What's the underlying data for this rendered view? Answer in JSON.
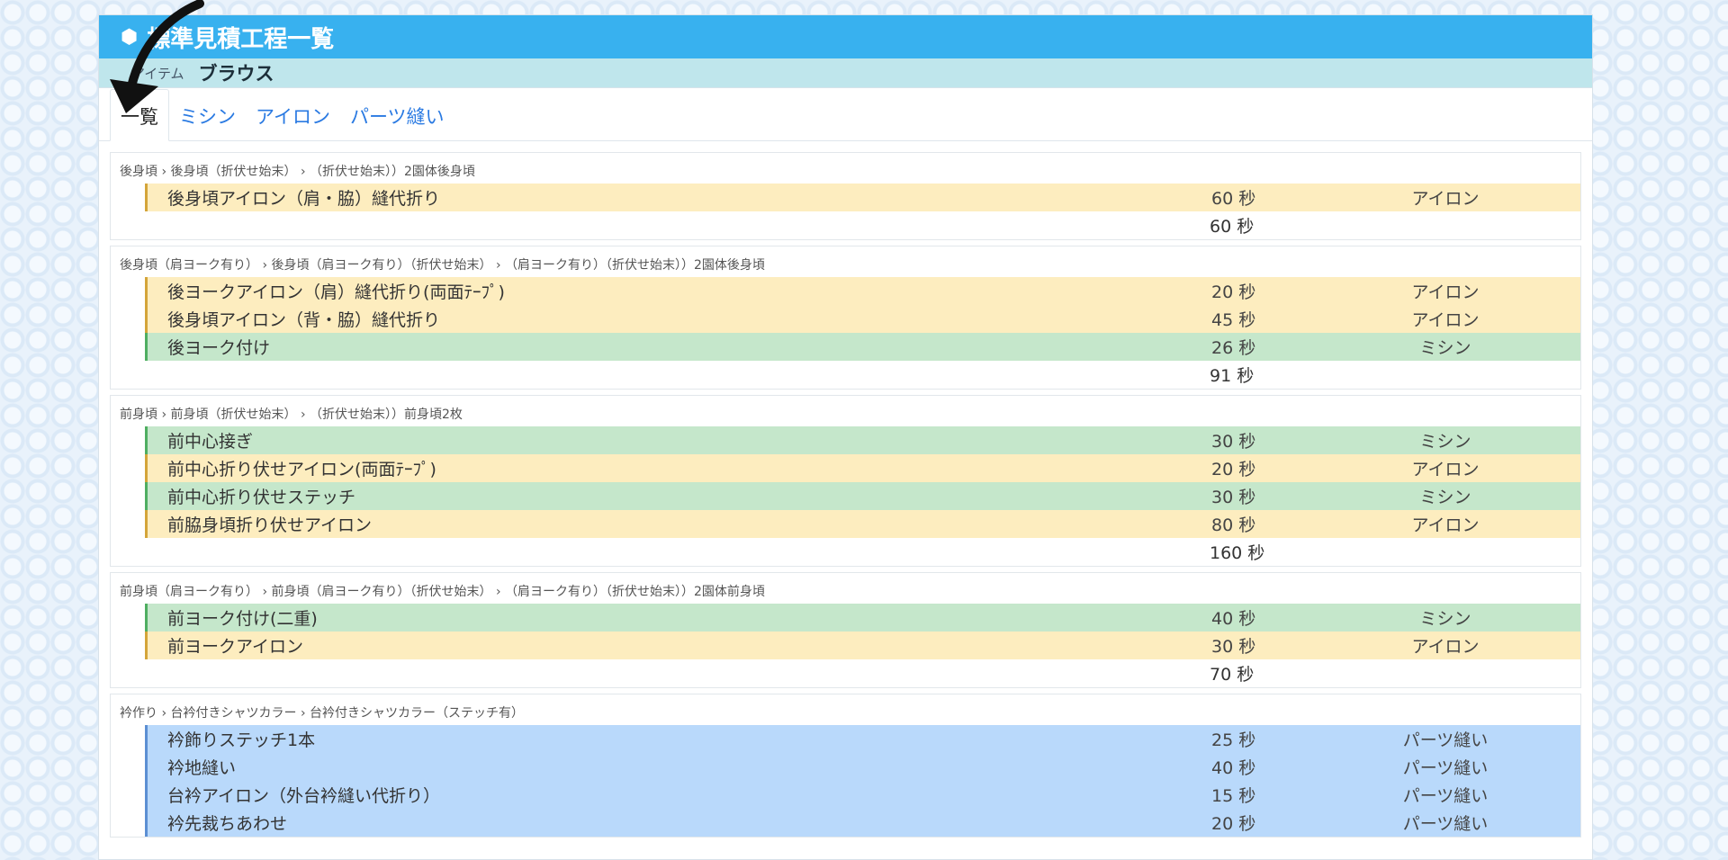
{
  "header": {
    "icon": "cube-icon",
    "title": "標準見積工程一覧"
  },
  "item": {
    "label": "アイテム",
    "value": "ブラウス"
  },
  "tabs": [
    {
      "label": "一覧",
      "active": true
    },
    {
      "label": "ミシン"
    },
    {
      "label": "アイロン"
    },
    {
      "label": "パーツ縫い"
    }
  ],
  "groups": [
    {
      "path": "後身頃 › 後身頃（折伏せ始末） › （折伏せ始末））2園体後身頃",
      "rows": [
        {
          "name": "後身頃アイロン（肩・脇）縫代折り",
          "time": "60 秒",
          "kind": "アイロン",
          "type": "iron"
        }
      ],
      "total": "60 秒"
    },
    {
      "path": "後身頃（肩ヨーク有り） › 後身頃（肩ヨーク有り）（折伏せ始末） › （肩ヨーク有り）（折伏せ始末））2園体後身頃",
      "rows": [
        {
          "name": "後ヨークアイロン（肩）縫代折り(両面ﾃｰﾌﾟ)",
          "time": "20 秒",
          "kind": "アイロン",
          "type": "iron"
        },
        {
          "name": "後身頃アイロン（背・脇）縫代折り",
          "time": "45 秒",
          "kind": "アイロン",
          "type": "iron"
        },
        {
          "name": "後ヨーク付け",
          "time": "26 秒",
          "kind": "ミシン",
          "type": "mishin"
        }
      ],
      "total": "91 秒"
    },
    {
      "path": "前身頃 › 前身頃（折伏せ始末） › （折伏せ始末））前身頃2枚",
      "rows": [
        {
          "name": "前中心接ぎ",
          "time": "30 秒",
          "kind": "ミシン",
          "type": "mishin"
        },
        {
          "name": "前中心折り伏せアイロン(両面ﾃｰﾌﾟ)",
          "time": "20 秒",
          "kind": "アイロン",
          "type": "iron"
        },
        {
          "name": "前中心折り伏せステッチ",
          "time": "30 秒",
          "kind": "ミシン",
          "type": "mishin"
        },
        {
          "name": "前脇身頃折り伏せアイロン",
          "time": "80 秒",
          "kind": "アイロン",
          "type": "iron"
        }
      ],
      "total": "160 秒"
    },
    {
      "path": "前身頃（肩ヨーク有り） › 前身頃（肩ヨーク有り）（折伏せ始末） › （肩ヨーク有り）（折伏せ始末））2園体前身頃",
      "rows": [
        {
          "name": "前ヨーク付け(二重)",
          "time": "40 秒",
          "kind": "ミシン",
          "type": "mishin"
        },
        {
          "name": "前ヨークアイロン",
          "time": "30 秒",
          "kind": "アイロン",
          "type": "iron"
        }
      ],
      "total": "70 秒"
    },
    {
      "path": "衿作り › 台衿付きシャツカラー › 台衿付きシャツカラー（ステッチ有）",
      "rows": [
        {
          "name": "衿飾りステッチ1本",
          "time": "25 秒",
          "kind": "パーツ縫い",
          "type": "parts"
        },
        {
          "name": "衿地縫い",
          "time": "40 秒",
          "kind": "パーツ縫い",
          "type": "parts"
        },
        {
          "name": "台衿アイロン（外台衿縫い代折り）",
          "time": "15 秒",
          "kind": "パーツ縫い",
          "type": "parts"
        },
        {
          "name": "衿先裁ちあわせ",
          "time": "20 秒",
          "kind": "パーツ縫い",
          "type": "parts"
        }
      ],
      "total": ""
    }
  ]
}
